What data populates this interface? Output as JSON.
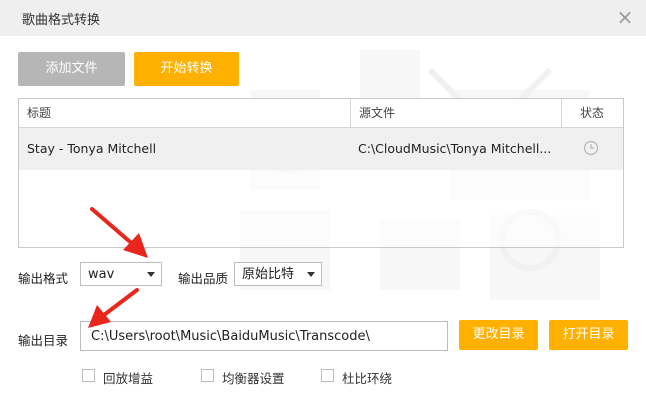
{
  "dialog": {
    "title": "歌曲格式转换",
    "close_symbol": "×"
  },
  "toolbar": {
    "add_file_label": "添加文件",
    "start_convert_label": "开始转换"
  },
  "table": {
    "headers": {
      "title": "标题",
      "source": "源文件",
      "status": "状态"
    },
    "rows": [
      {
        "title": "Stay - Tonya Mitchell",
        "source": "C:\\CloudMusic\\Tonya  Mitchell...",
        "status_icon": "clock-icon"
      }
    ]
  },
  "output": {
    "format_label": "输出格式",
    "format_value": "wav",
    "quality_label": "输出品质",
    "quality_value": "原始比特",
    "dir_label": "输出目录",
    "dir_value": "C:\\Users\\root\\Music\\BaiduMusic\\Transcode\\",
    "change_dir_label": "更改目录",
    "open_dir_label": "打开目录"
  },
  "options": [
    {
      "label": "回放增益",
      "checked": false
    },
    {
      "label": "均衡器设置",
      "checked": false
    },
    {
      "label": "杜比环绕",
      "checked": false
    }
  ],
  "colors": {
    "accent": "#ffb000",
    "disabled_button": "#b6b6b6",
    "annotation_arrow": "#e8261c"
  }
}
